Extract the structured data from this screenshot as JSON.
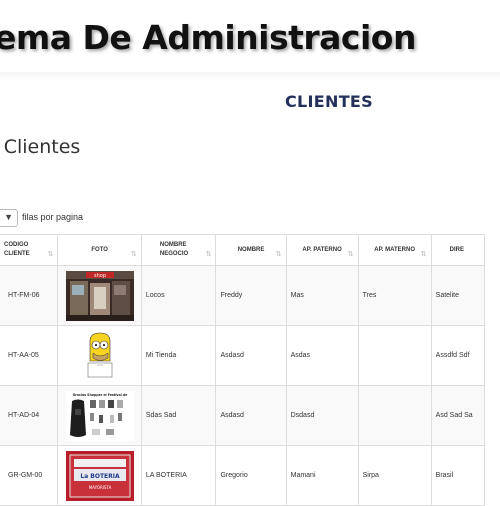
{
  "app": {
    "title": "ema De Administracion"
  },
  "page": {
    "section_title": "CLIENTES",
    "list_heading": "e Clientes",
    "page_size_label": "filas por pagina"
  },
  "table": {
    "columns": [
      {
        "label": "CODIGO\nCLIENTE",
        "name": "col-codigo-cliente"
      },
      {
        "label": "FOTO",
        "name": "col-foto"
      },
      {
        "label": "NOMBRE\nNEGOCIO",
        "name": "col-nombre-negocio"
      },
      {
        "label": "NOMBRE",
        "name": "col-nombre"
      },
      {
        "label": "AP. PATERNO",
        "name": "col-ap-paterno"
      },
      {
        "label": "AP. MATERNO",
        "name": "col-ap-materno"
      },
      {
        "label": "DIRE",
        "name": "col-direccion"
      }
    ],
    "rows": [
      {
        "codigo": "HT-FM-06",
        "foto": "storefront-photo",
        "negocio": "Locos",
        "nombre": "Freddy",
        "paterno": "Mas",
        "materno": "Tres",
        "direccion": "Satelite"
      },
      {
        "codigo": "HT-AA-05",
        "foto": "cartoon-character-photo",
        "negocio": "Mi Tienda",
        "nombre": "Asdasd",
        "paterno": "Asdas",
        "materno": "",
        "direccion": "Assdfd Sdf"
      },
      {
        "codigo": "HT-AD-04",
        "foto": "product-flyer-photo",
        "negocio": "Sdas Sad",
        "nombre": "Asdasd",
        "paterno": "Dsdasd",
        "materno": "",
        "direccion": "Asd Sad Sa"
      },
      {
        "codigo": "GR-GM-00",
        "foto": "boteria-sign-photo",
        "negocio": "LA BOTERIA",
        "nombre": "Gregorio",
        "paterno": "Mamani",
        "materno": "Sirpa",
        "direccion": "Brasil"
      }
    ]
  },
  "photo_texts": {
    "storefront": "shop",
    "flyer_title": "Gracias Shopper el Festival de",
    "sign_line1": "La BOTERIA",
    "sign_line2": "MAYORISTA"
  }
}
